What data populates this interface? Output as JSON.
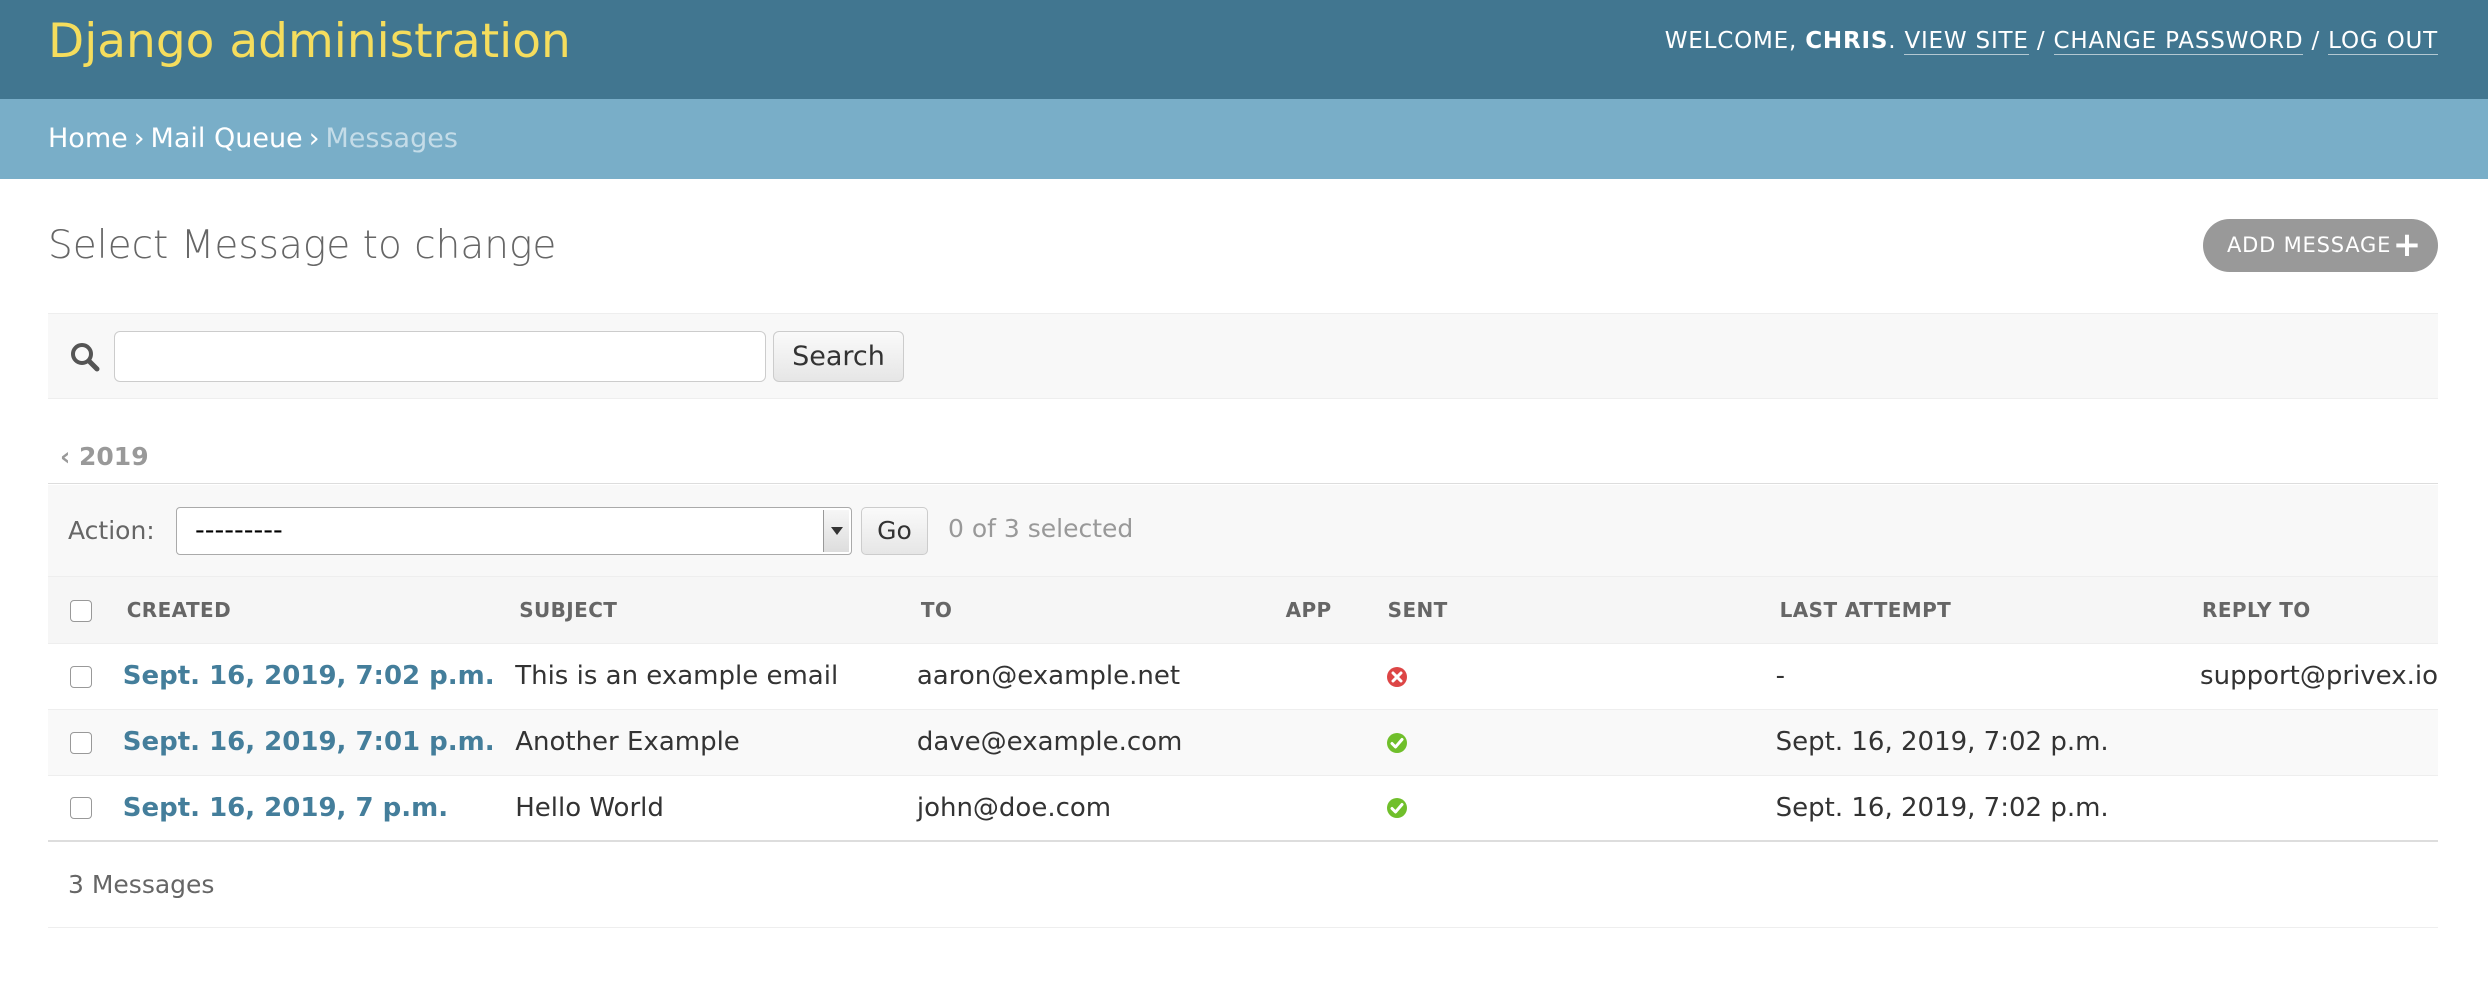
{
  "header": {
    "site_title": "Django administration",
    "welcome": "WELCOME, ",
    "username": "CHRIS",
    "username_suffix": ".",
    "view_site": "VIEW SITE",
    "change_password": "CHANGE PASSWORD",
    "log_out": "LOG OUT",
    "separator": "/"
  },
  "breadcrumbs": {
    "home": "Home",
    "app": "Mail Queue",
    "current": "Messages",
    "sep": "›"
  },
  "page": {
    "title": "Select Message to change",
    "add_button": "ADD MESSAGE",
    "add_icon": "+"
  },
  "search": {
    "value": "",
    "button": "Search",
    "icon": "search-icon"
  },
  "date_hierarchy": {
    "back": "‹ 2019"
  },
  "actions": {
    "label": "Action:",
    "selected": "---------",
    "go": "Go",
    "counter": "0 of 3 selected"
  },
  "table": {
    "columns": [
      "Created",
      "Subject",
      "To",
      "App",
      "Sent",
      "Last attempt",
      "Reply to"
    ],
    "rows": [
      {
        "created": "Sept. 16, 2019, 7:02 p.m.",
        "subject": "This is an example email",
        "to": "aaron@example.net",
        "app": "",
        "sent": "no",
        "last_attempt": "-",
        "reply_to": "support@privex.io"
      },
      {
        "created": "Sept. 16, 2019, 7:01 p.m.",
        "subject": "Another Example",
        "to": "dave@example.com",
        "app": "",
        "sent": "yes",
        "last_attempt": "Sept. 16, 2019, 7:02 p.m.",
        "reply_to": ""
      },
      {
        "created": "Sept. 16, 2019, 7 p.m.",
        "subject": "Hello World",
        "to": "john@doe.com",
        "app": "",
        "sent": "yes",
        "last_attempt": "Sept. 16, 2019, 7:02 p.m.",
        "reply_to": ""
      }
    ]
  },
  "paginator": {
    "count": "3 Messages"
  },
  "colors": {
    "header": "#417690",
    "breadcrumbs": "#79aec8",
    "brand_yellow": "#f5dd5d",
    "link": "#447e9b",
    "yes": "#70bf2b",
    "no": "#dd4646"
  }
}
